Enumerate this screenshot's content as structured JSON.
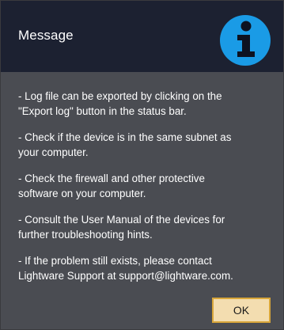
{
  "dialog": {
    "title": "Message",
    "icon": "info-icon",
    "paragraphs": [
      {
        "lines": [
          "- Log file can be exported by clicking on the",
          "\"Export log\" button in the status bar."
        ]
      },
      {
        "lines": [
          "- Check if the device is in the same subnet as",
          "your computer."
        ]
      },
      {
        "lines": [
          "- Check the firewall and other protective",
          "software on your computer."
        ]
      },
      {
        "lines": [
          "- Consult the User Manual of the devices for",
          "further troubleshooting hints."
        ]
      },
      {
        "lines": [
          "- If the problem still exists, please contact",
          "Lightware Support at support@lightware.com."
        ]
      }
    ],
    "ok_label": "OK"
  },
  "colors": {
    "titlebar": "#1c2131",
    "body": "#4a4c52",
    "icon_circle": "#1a9be6",
    "ok_background": "#f3ddb0",
    "ok_border": "#d8a63a"
  }
}
